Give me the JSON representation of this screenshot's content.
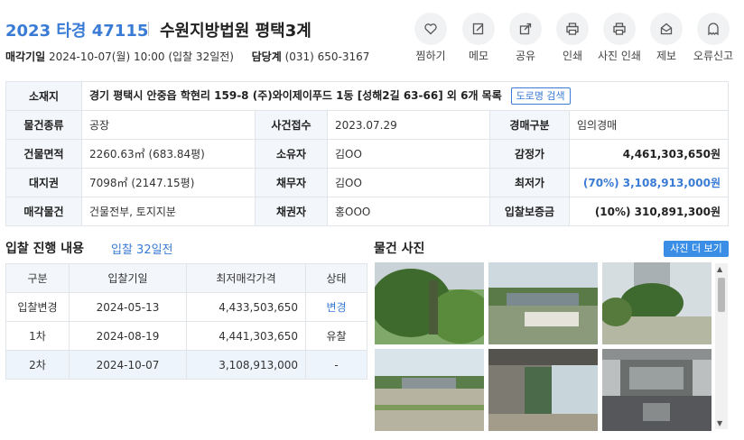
{
  "header": {
    "case_no": "2023 타경 47115",
    "court": "수원지방법원 평택3계",
    "sale_date_label": "매각기일",
    "sale_date": "2024-10-07(월) 10:00 (입찰 32일전)",
    "dept_label": "담당계",
    "dept_phone": "(031) 650-3167"
  },
  "actions": [
    {
      "label": "찜하기",
      "icon": "heart-icon"
    },
    {
      "label": "메모",
      "icon": "memo-icon"
    },
    {
      "label": "공유",
      "icon": "share-icon"
    },
    {
      "label": "인쇄",
      "icon": "print-icon"
    },
    {
      "label": "사진 인쇄",
      "icon": "print-icon"
    },
    {
      "label": "제보",
      "icon": "report-icon"
    },
    {
      "label": "오류신고",
      "icon": "ghost-icon"
    }
  ],
  "info": {
    "address_label": "소재지",
    "address": "경기 평택시 안중읍 학현리 159-8 (주)와이제이푸드 1동 [성해2길 63-66] 외 6개 목록",
    "road_btn": "도로명 검색",
    "rows": [
      [
        {
          "h": "물건종류"
        },
        {
          "v": "공장"
        },
        {
          "h": "사건접수"
        },
        {
          "v": "2023.07.29"
        },
        {
          "h": "경매구분"
        },
        {
          "v": "임의경매"
        }
      ],
      [
        {
          "h": "건물면적"
        },
        {
          "v": "2260.63㎡ (683.84평)"
        },
        {
          "h": "소유자"
        },
        {
          "v": "김OO"
        },
        {
          "h": "감정가"
        },
        {
          "v": "4,461,303,650원"
        }
      ],
      [
        {
          "h": "대지권"
        },
        {
          "v": "7098㎡ (2147.15평)"
        },
        {
          "h": "채무자"
        },
        {
          "v": "김OO"
        },
        {
          "h": "최저가"
        },
        {
          "v": "(70%) 3,108,913,000원"
        }
      ],
      [
        {
          "h": "매각물건"
        },
        {
          "v": "건물전부, 토지지분"
        },
        {
          "h": "채권자"
        },
        {
          "v": "홍OOO"
        },
        {
          "h": "입찰보증금"
        },
        {
          "v": "(10%) 310,891,300원"
        }
      ]
    ]
  },
  "bidding": {
    "title": "입찰 진행 내용",
    "sub": "입찰 32일전",
    "columns": [
      "구분",
      "입찰기일",
      "최저매각가격",
      "상태"
    ],
    "rows": [
      [
        "입찰변경",
        "2024-05-13",
        "4,433,503,650",
        "변경"
      ],
      [
        "1차",
        "2024-08-19",
        "4,441,303,650",
        "유찰"
      ],
      [
        "2차",
        "2024-10-07",
        "3,108,913,000",
        "-"
      ]
    ]
  },
  "photos": {
    "title": "물건 사진",
    "more_btn": "사진 더 보기"
  },
  "colors": {
    "accent": "#3a7bd5",
    "header_cell": "#f3f6fa",
    "border": "#e1e4e8",
    "button": "#3a8ee6"
  }
}
